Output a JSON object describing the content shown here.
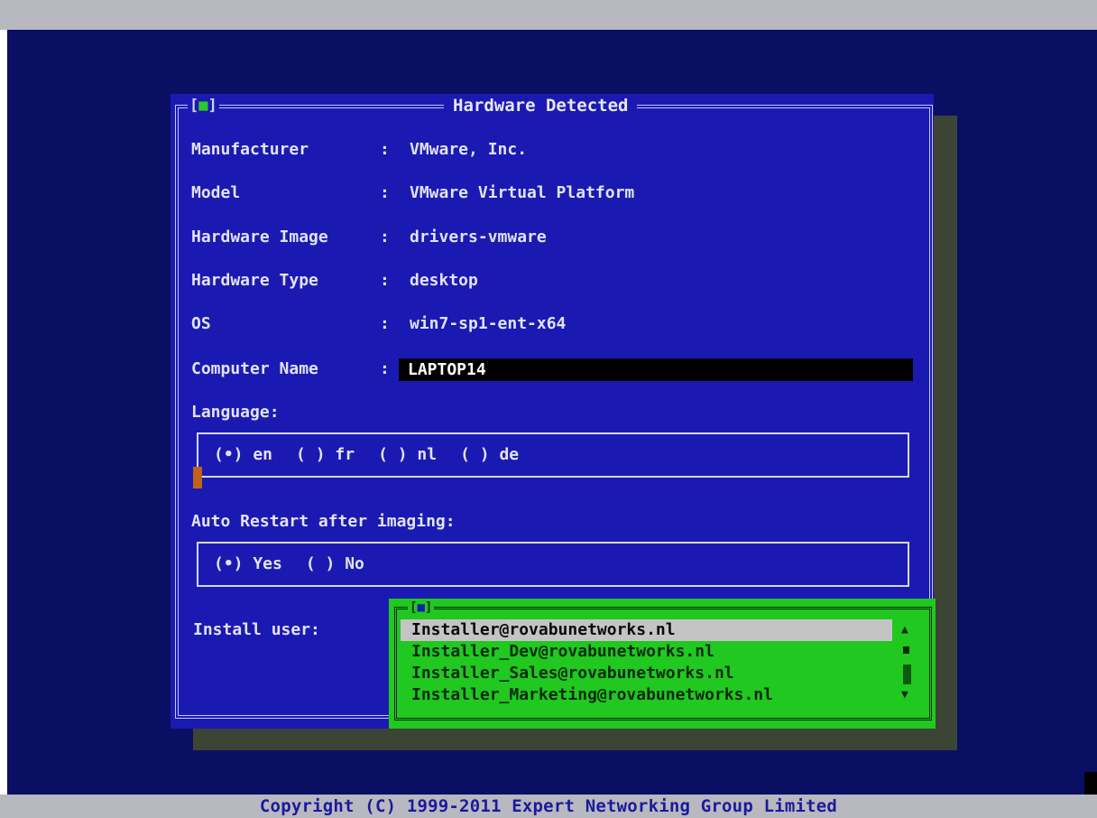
{
  "dialog": {
    "tag": "[",
    "tag_dot": "■",
    "tag_close": "]",
    "title": "Hardware Detected"
  },
  "fields": [
    {
      "label": "Manufacturer",
      "value": "VMware, Inc."
    },
    {
      "label": "Model",
      "value": "VMware Virtual Platform"
    },
    {
      "label": "Hardware Image",
      "value": "drivers-vmware"
    },
    {
      "label": "Hardware Type",
      "value": "desktop"
    },
    {
      "label": "OS",
      "value": "win7-sp1-ent-x64"
    }
  ],
  "computer_name": {
    "label": "Computer Name",
    "value": "LAPTOP14"
  },
  "colon": ":",
  "language": {
    "label": "Language:",
    "options": [
      "(•) en",
      "( ) fr",
      "( ) nl",
      "( ) de"
    ]
  },
  "auto_restart": {
    "label": "Auto Restart after imaging:",
    "options": [
      "(•) Yes",
      "( ) No"
    ]
  },
  "install_user": {
    "label": "Install user:",
    "options": [
      "Installer@rovabunetworks.nl",
      "Installer_Dev@rovabunetworks.nl",
      "Installer_Sales@rovabunetworks.nl",
      "Installer_Marketing@rovabunetworks.nl"
    ],
    "selected_index": 0
  },
  "scroll": {
    "up": "▲",
    "down": "▼"
  },
  "footer": {
    "copyright": "Copyright (C) 1999-2011 Expert Networking Group Limited"
  },
  "colors": {
    "screen_bg": "#0b0f63",
    "dialog_bg": "#1a1ab3",
    "list_bg": "#20c820",
    "selection": "#c4c4c4",
    "cursor": "#c0621a"
  }
}
